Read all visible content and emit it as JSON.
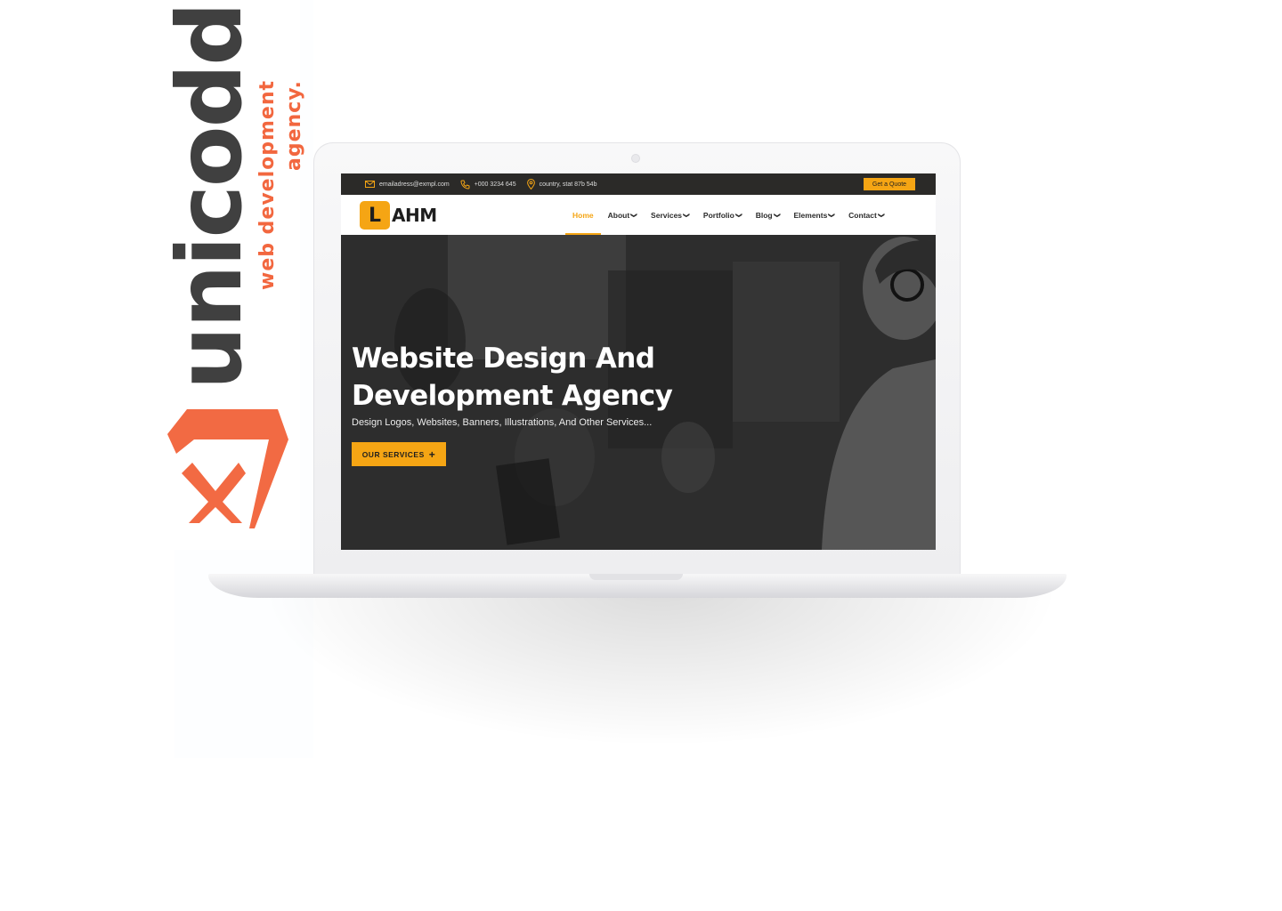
{
  "brand": {
    "name": "unicodd",
    "tagline": "web development agency.",
    "accent_color": "#f2673f"
  },
  "website": {
    "topbar": {
      "email": "emailadress@exmpl.com",
      "phone": "+000 3234 645",
      "address": "country, stat 87b 54b",
      "quote_button": "Get a Quote"
    },
    "logo": {
      "mark": "L",
      "text": "AHM"
    },
    "nav": [
      {
        "label": "Home",
        "active": true,
        "dropdown": false
      },
      {
        "label": "About",
        "active": false,
        "dropdown": true
      },
      {
        "label": "Services",
        "active": false,
        "dropdown": true
      },
      {
        "label": "Portfolio",
        "active": false,
        "dropdown": true
      },
      {
        "label": "Blog",
        "active": false,
        "dropdown": true
      },
      {
        "label": "Elements",
        "active": false,
        "dropdown": true
      },
      {
        "label": "Contact",
        "active": false,
        "dropdown": true
      }
    ],
    "hero": {
      "title_line1": "Website Design And",
      "title_line2": "Development Agency",
      "subtitle": "Design Logos, Websites, Banners, Illustrations, And Other Services...",
      "button": "OUR SERVICES"
    },
    "accent_color": "#f5a514"
  }
}
